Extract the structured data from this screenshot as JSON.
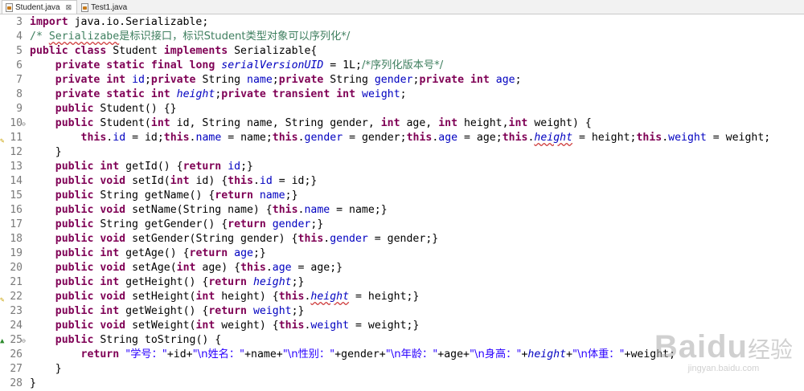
{
  "tabs": [
    {
      "label": "Student.java",
      "active": true,
      "close": "⊠"
    },
    {
      "label": "Test1.java",
      "active": false
    }
  ],
  "watermark": {
    "brand": "Baidu",
    "cn": "经验",
    "url": "jingyan.baidu.com"
  },
  "colors": {
    "keyword": "#7f0055",
    "field": "#0000c0",
    "string": "#2a00ff",
    "comment": "#3f7f5f"
  },
  "lines": [
    {
      "no": "3",
      "tokens": [
        {
          "t": "import",
          "c": "k"
        },
        {
          "t": " java.io.Serializable;"
        }
      ]
    },
    {
      "no": "4",
      "tokens": [
        {
          "t": "/* ",
          "c": "c"
        },
        {
          "t": "Serializabe",
          "c": "c squiggle"
        },
        {
          "t": "是标识接口，标识Student类型对象可以序列化*/",
          "c": "c cjk"
        }
      ]
    },
    {
      "no": "5",
      "tokens": [
        {
          "t": "public",
          "c": "k"
        },
        {
          "t": " "
        },
        {
          "t": "class",
          "c": "k"
        },
        {
          "t": " Student "
        },
        {
          "t": "implements",
          "c": "k"
        },
        {
          "t": " Serializable{"
        }
      ]
    },
    {
      "no": "6",
      "tokens": [
        {
          "t": "    "
        },
        {
          "t": "private",
          "c": "k"
        },
        {
          "t": " "
        },
        {
          "t": "static",
          "c": "k"
        },
        {
          "t": " "
        },
        {
          "t": "final",
          "c": "k"
        },
        {
          "t": " "
        },
        {
          "t": "long",
          "c": "k"
        },
        {
          "t": " "
        },
        {
          "t": "serialVersionUID",
          "c": "fi"
        },
        {
          "t": " = 1L;"
        },
        {
          "t": "/*序列化版本号*/",
          "c": "c cjk"
        }
      ]
    },
    {
      "no": "7",
      "tokens": [
        {
          "t": "    "
        },
        {
          "t": "private",
          "c": "k"
        },
        {
          "t": " "
        },
        {
          "t": "int",
          "c": "k"
        },
        {
          "t": " "
        },
        {
          "t": "id",
          "c": "f"
        },
        {
          "t": ";"
        },
        {
          "t": "private",
          "c": "k"
        },
        {
          "t": " String "
        },
        {
          "t": "name",
          "c": "f"
        },
        {
          "t": ";"
        },
        {
          "t": "private",
          "c": "k"
        },
        {
          "t": " String "
        },
        {
          "t": "gender",
          "c": "f"
        },
        {
          "t": ";"
        },
        {
          "t": "private",
          "c": "k"
        },
        {
          "t": " "
        },
        {
          "t": "int",
          "c": "k"
        },
        {
          "t": " "
        },
        {
          "t": "age",
          "c": "f"
        },
        {
          "t": ";"
        }
      ]
    },
    {
      "no": "8",
      "tokens": [
        {
          "t": "    "
        },
        {
          "t": "private",
          "c": "k"
        },
        {
          "t": " "
        },
        {
          "t": "static",
          "c": "k"
        },
        {
          "t": " "
        },
        {
          "t": "int",
          "c": "k"
        },
        {
          "t": " "
        },
        {
          "t": "height",
          "c": "fi"
        },
        {
          "t": ";"
        },
        {
          "t": "private",
          "c": "k"
        },
        {
          "t": " "
        },
        {
          "t": "transient",
          "c": "k"
        },
        {
          "t": " "
        },
        {
          "t": "int",
          "c": "k"
        },
        {
          "t": " "
        },
        {
          "t": "weight",
          "c": "f"
        },
        {
          "t": ";"
        }
      ]
    },
    {
      "no": "9",
      "tokens": [
        {
          "t": "    "
        },
        {
          "t": "public",
          "c": "k"
        },
        {
          "t": " Student() {}"
        }
      ]
    },
    {
      "no": "10",
      "fold": "⊖",
      "tokens": [
        {
          "t": "    "
        },
        {
          "t": "public",
          "c": "k"
        },
        {
          "t": " Student("
        },
        {
          "t": "int",
          "c": "k"
        },
        {
          "t": " id, String name, String gender, "
        },
        {
          "t": "int",
          "c": "k"
        },
        {
          "t": " age, "
        },
        {
          "t": "int",
          "c": "k"
        },
        {
          "t": " height,"
        },
        {
          "t": "int",
          "c": "k"
        },
        {
          "t": " weight) {"
        }
      ]
    },
    {
      "no": "11",
      "marker": "✎",
      "tokens": [
        {
          "t": "        "
        },
        {
          "t": "this",
          "c": "k"
        },
        {
          "t": "."
        },
        {
          "t": "id",
          "c": "f"
        },
        {
          "t": " = id;"
        },
        {
          "t": "this",
          "c": "k"
        },
        {
          "t": "."
        },
        {
          "t": "name",
          "c": "f"
        },
        {
          "t": " = name;"
        },
        {
          "t": "this",
          "c": "k"
        },
        {
          "t": "."
        },
        {
          "t": "gender",
          "c": "f"
        },
        {
          "t": " = gender;"
        },
        {
          "t": "this",
          "c": "k"
        },
        {
          "t": "."
        },
        {
          "t": "age",
          "c": "f"
        },
        {
          "t": " = age;"
        },
        {
          "t": "this",
          "c": "k"
        },
        {
          "t": "."
        },
        {
          "t": "height",
          "c": "fi squiggle"
        },
        {
          "t": " = height;"
        },
        {
          "t": "this",
          "c": "k"
        },
        {
          "t": "."
        },
        {
          "t": "weight",
          "c": "f"
        },
        {
          "t": " = weight;"
        }
      ]
    },
    {
      "no": "12",
      "tokens": [
        {
          "t": "    }"
        }
      ]
    },
    {
      "no": "13",
      "tokens": [
        {
          "t": "    "
        },
        {
          "t": "public",
          "c": "k"
        },
        {
          "t": " "
        },
        {
          "t": "int",
          "c": "k"
        },
        {
          "t": " getId() {"
        },
        {
          "t": "return",
          "c": "k"
        },
        {
          "t": " "
        },
        {
          "t": "id",
          "c": "f"
        },
        {
          "t": ";}"
        }
      ]
    },
    {
      "no": "14",
      "tokens": [
        {
          "t": "    "
        },
        {
          "t": "public",
          "c": "k"
        },
        {
          "t": " "
        },
        {
          "t": "void",
          "c": "k"
        },
        {
          "t": " setId("
        },
        {
          "t": "int",
          "c": "k"
        },
        {
          "t": " id) {"
        },
        {
          "t": "this",
          "c": "k"
        },
        {
          "t": "."
        },
        {
          "t": "id",
          "c": "f"
        },
        {
          "t": " = id;}"
        }
      ]
    },
    {
      "no": "15",
      "tokens": [
        {
          "t": "    "
        },
        {
          "t": "public",
          "c": "k"
        },
        {
          "t": " String getName() {"
        },
        {
          "t": "return",
          "c": "k"
        },
        {
          "t": " "
        },
        {
          "t": "name",
          "c": "f"
        },
        {
          "t": ";}"
        }
      ]
    },
    {
      "no": "16",
      "tokens": [
        {
          "t": "    "
        },
        {
          "t": "public",
          "c": "k"
        },
        {
          "t": " "
        },
        {
          "t": "void",
          "c": "k"
        },
        {
          "t": " setName(String name) {"
        },
        {
          "t": "this",
          "c": "k"
        },
        {
          "t": "."
        },
        {
          "t": "name",
          "c": "f"
        },
        {
          "t": " = name;}"
        }
      ]
    },
    {
      "no": "17",
      "tokens": [
        {
          "t": "    "
        },
        {
          "t": "public",
          "c": "k"
        },
        {
          "t": " String getGender() {"
        },
        {
          "t": "return",
          "c": "k"
        },
        {
          "t": " "
        },
        {
          "t": "gender",
          "c": "f"
        },
        {
          "t": ";}"
        }
      ]
    },
    {
      "no": "18",
      "tokens": [
        {
          "t": "    "
        },
        {
          "t": "public",
          "c": "k"
        },
        {
          "t": " "
        },
        {
          "t": "void",
          "c": "k"
        },
        {
          "t": " setGender(String gender) {"
        },
        {
          "t": "this",
          "c": "k"
        },
        {
          "t": "."
        },
        {
          "t": "gender",
          "c": "f"
        },
        {
          "t": " = gender;}"
        }
      ]
    },
    {
      "no": "19",
      "tokens": [
        {
          "t": "    "
        },
        {
          "t": "public",
          "c": "k"
        },
        {
          "t": " "
        },
        {
          "t": "int",
          "c": "k"
        },
        {
          "t": " getAge() {"
        },
        {
          "t": "return",
          "c": "k"
        },
        {
          "t": " "
        },
        {
          "t": "age",
          "c": "f"
        },
        {
          "t": ";}"
        }
      ]
    },
    {
      "no": "20",
      "tokens": [
        {
          "t": "    "
        },
        {
          "t": "public",
          "c": "k"
        },
        {
          "t": " "
        },
        {
          "t": "void",
          "c": "k"
        },
        {
          "t": " setAge("
        },
        {
          "t": "int",
          "c": "k"
        },
        {
          "t": " age) {"
        },
        {
          "t": "this",
          "c": "k"
        },
        {
          "t": "."
        },
        {
          "t": "age",
          "c": "f"
        },
        {
          "t": " = age;}"
        }
      ]
    },
    {
      "no": "21",
      "tokens": [
        {
          "t": "    "
        },
        {
          "t": "public",
          "c": "k"
        },
        {
          "t": " "
        },
        {
          "t": "int",
          "c": "k"
        },
        {
          "t": " getHeight() {"
        },
        {
          "t": "return",
          "c": "k"
        },
        {
          "t": " "
        },
        {
          "t": "height",
          "c": "fi"
        },
        {
          "t": ";}"
        }
      ]
    },
    {
      "no": "22",
      "marker": "✎",
      "tokens": [
        {
          "t": "    "
        },
        {
          "t": "public",
          "c": "k"
        },
        {
          "t": " "
        },
        {
          "t": "void",
          "c": "k"
        },
        {
          "t": " setHeight("
        },
        {
          "t": "int",
          "c": "k"
        },
        {
          "t": " height) {"
        },
        {
          "t": "this",
          "c": "k"
        },
        {
          "t": "."
        },
        {
          "t": "height",
          "c": "fi squiggle"
        },
        {
          "t": " = height;}"
        }
      ]
    },
    {
      "no": "23",
      "tokens": [
        {
          "t": "    "
        },
        {
          "t": "public",
          "c": "k"
        },
        {
          "t": " "
        },
        {
          "t": "int",
          "c": "k"
        },
        {
          "t": " getWeight() {"
        },
        {
          "t": "return",
          "c": "k"
        },
        {
          "t": " "
        },
        {
          "t": "weight",
          "c": "f"
        },
        {
          "t": ";}"
        }
      ]
    },
    {
      "no": "24",
      "tokens": [
        {
          "t": "    "
        },
        {
          "t": "public",
          "c": "k"
        },
        {
          "t": " "
        },
        {
          "t": "void",
          "c": "k"
        },
        {
          "t": " setWeight("
        },
        {
          "t": "int",
          "c": "k"
        },
        {
          "t": " weight) {"
        },
        {
          "t": "this",
          "c": "k"
        },
        {
          "t": "."
        },
        {
          "t": "weight",
          "c": "f"
        },
        {
          "t": " = weight;}"
        }
      ]
    },
    {
      "no": "25",
      "fold": "⊖",
      "upmark": "▲",
      "tokens": [
        {
          "t": "    "
        },
        {
          "t": "public",
          "c": "k"
        },
        {
          "t": " String toString() {"
        }
      ]
    },
    {
      "no": "26",
      "tokens": [
        {
          "t": "        "
        },
        {
          "t": "return",
          "c": "k"
        },
        {
          "t": " "
        },
        {
          "t": "\"学号：\"",
          "c": "s cjk"
        },
        {
          "t": "+id+"
        },
        {
          "t": "\"\\n姓名：\"",
          "c": "s cjk"
        },
        {
          "t": "+name+"
        },
        {
          "t": "\"\\n性别：\"",
          "c": "s cjk"
        },
        {
          "t": "+gender+"
        },
        {
          "t": "\"\\n年龄：\"",
          "c": "s cjk"
        },
        {
          "t": "+age+"
        },
        {
          "t": "\"\\n身高：\"",
          "c": "s cjk"
        },
        {
          "t": "+"
        },
        {
          "t": "height",
          "c": "fi"
        },
        {
          "t": "+"
        },
        {
          "t": "\"\\n体重：\"",
          "c": "s cjk"
        },
        {
          "t": "+weight;"
        }
      ]
    },
    {
      "no": "27",
      "tokens": [
        {
          "t": "    }"
        }
      ]
    },
    {
      "no": "28",
      "tokens": [
        {
          "t": "}"
        }
      ]
    }
  ]
}
